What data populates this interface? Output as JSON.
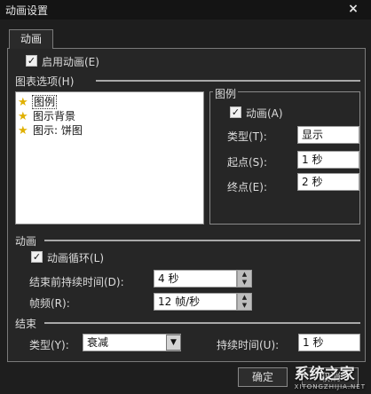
{
  "window": {
    "title": "动画设置"
  },
  "tab": {
    "label": "动画"
  },
  "enable_animation": {
    "label": "启用动画(E)",
    "checked": true
  },
  "chart_options": {
    "label": "图表选项(H)",
    "items": [
      {
        "label": "图例",
        "selected": true
      },
      {
        "label": "图示背景",
        "selected": false
      },
      {
        "label": "图示: 饼图",
        "selected": false
      }
    ]
  },
  "legend_group": {
    "title": "图例",
    "animation_label": "动画(A)",
    "animation_checked": true,
    "type_label": "类型(T):",
    "type_value": "显示",
    "start_label": "起点(S):",
    "start_value": "1 秒",
    "end_label": "终点(E):",
    "end_value": "2 秒"
  },
  "animation_section": {
    "label": "动画",
    "loop_label": "动画循环(L)",
    "loop_checked": true,
    "hold_label": "结束前持续时间(D):",
    "hold_value": "4 秒",
    "fps_label": "帧频(R):",
    "fps_value": "12 帧/秒"
  },
  "end_section": {
    "label": "结束",
    "type_label": "类型(Y):",
    "type_value": "衰减",
    "duration_label": "持续时间(U):",
    "duration_value": "1 秒"
  },
  "buttons": {
    "ok": "确定",
    "cancel": "取消"
  },
  "watermark": {
    "text": "系统之家",
    "sub": "XITONGZHIJIA.NET"
  }
}
